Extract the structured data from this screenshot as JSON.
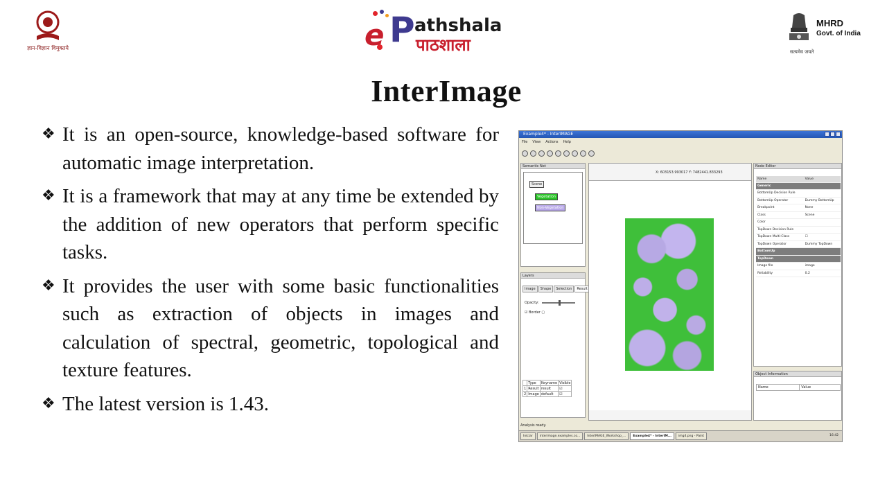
{
  "header": {
    "left_logo_caption": "ज्ञान-विज्ञान विमुक्तये",
    "center_logo_prefix": "e",
    "center_logo_word_en": "athshala",
    "center_logo_p": "P",
    "center_logo_word_hi": "पाठशाला",
    "right_logo_line1": "MHRD",
    "right_logo_line2": "Govt. of India",
    "right_logo_motto": "सत्यमेव जयते"
  },
  "title": "InterImage",
  "bullets": [
    {
      "mark": "❖",
      "text": "It is an open-source, knowledge-based software for automatic image interpretation."
    },
    {
      "mark": "❖",
      "text": "It is a framework that may at any time be extended by the addition of new operators that perform specific tasks."
    },
    {
      "mark": "❖",
      "text": "It provides the user with some basic functionalities such as extraction of objects in images and calculation of spectral, geometric, topological and texture features."
    },
    {
      "mark": "❖",
      "text": "The latest version is 1.43."
    }
  ],
  "screenshot": {
    "window_title": "Example4* - InterIMAGE",
    "menu": [
      "File",
      "View",
      "Actions",
      "Help"
    ],
    "semantic_net": {
      "title": "Semantic Net",
      "nodes": [
        "Scene",
        "Vegetation",
        "Non-Vegetation"
      ]
    },
    "layers": {
      "title": "Layers",
      "tabs": [
        "Image",
        "Shape",
        "Selection",
        "Result"
      ],
      "opacity_label": "Opacity:",
      "border_label": "Border",
      "table_headers": [
        "",
        "Type",
        "Keyname",
        "Visible"
      ],
      "table_rows": [
        [
          "1",
          "Result",
          "result",
          "☑"
        ],
        [
          "2",
          "Image",
          "default",
          "☑"
        ]
      ]
    },
    "view": {
      "coords": "X: 603153.993017  Y: 7482441.833293"
    },
    "node_editor": {
      "title": "Node Editor",
      "headers": [
        "Name",
        "Value"
      ],
      "rows": [
        {
          "type": "grp",
          "name": "Generic",
          "value": ""
        },
        {
          "type": "row",
          "name": "BottomUp Decision Rule",
          "value": ""
        },
        {
          "type": "row",
          "name": "BottomUp Operator",
          "value": "Dummy BottomUp"
        },
        {
          "type": "row",
          "name": "Breakpoint",
          "value": "None"
        },
        {
          "type": "row",
          "name": "Class",
          "value": "Scene"
        },
        {
          "type": "row",
          "name": "Color",
          "value": ""
        },
        {
          "type": "row",
          "name": "TopDown Decision Rule",
          "value": ""
        },
        {
          "type": "row",
          "name": "TopDown Multi-Class",
          "value": "☐"
        },
        {
          "type": "row",
          "name": "TopDown Operator",
          "value": "Dummy TopDown"
        },
        {
          "type": "grp",
          "name": "BottomUp",
          "value": ""
        },
        {
          "type": "grp",
          "name": "TopDown",
          "value": ""
        },
        {
          "type": "row",
          "name": "Image file",
          "value": "image"
        },
        {
          "type": "row",
          "name": "Reliability",
          "value": "0.2"
        }
      ]
    },
    "object_info": {
      "title": "Object Information",
      "headers": [
        "Name",
        "Value"
      ]
    },
    "status": "Analysis ready.",
    "taskbar": [
      "Iniciar",
      "interimage.examples.co...",
      "InterIMAGE_Workshop_...",
      "Example4* - InterIM...",
      "img4.png - Paint"
    ],
    "clock": "16:42"
  }
}
